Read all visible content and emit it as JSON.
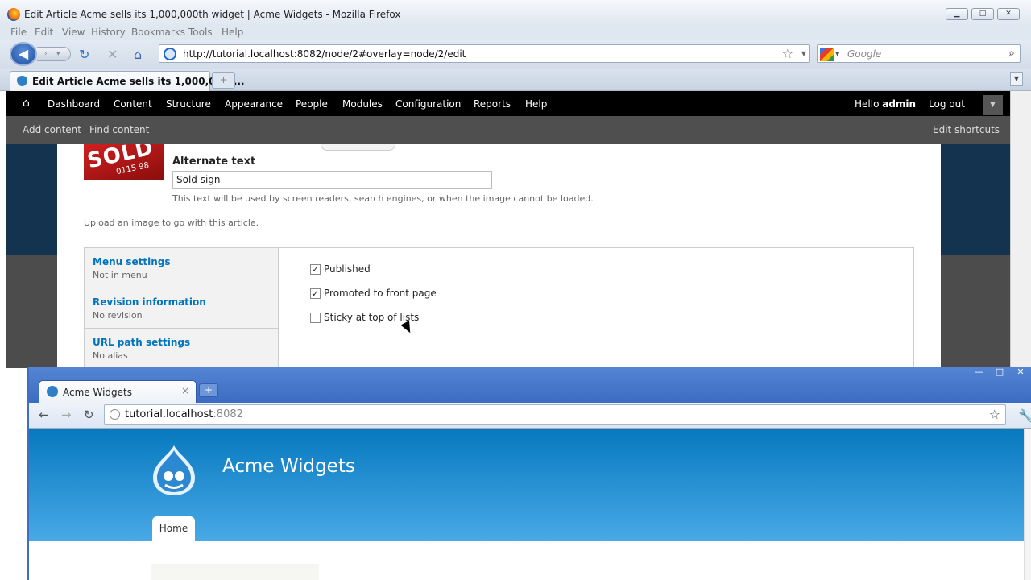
{
  "firefox": {
    "title": "Edit Article Acme sells its 1,000,000th widget | Acme Widgets - Mozilla Firefox",
    "menu": [
      "File",
      "Edit",
      "View",
      "History",
      "Bookmarks",
      "Tools",
      "Help"
    ],
    "url": "http://tutorial.localhost:8082/node/2#overlay=node/2/edit",
    "search_placeholder": "Google",
    "tab_label": "Edit Article Acme sells its 1,000,000t...",
    "new_tab": "+"
  },
  "toolbar": {
    "items": [
      "Dashboard",
      "Content",
      "Structure",
      "Appearance",
      "People",
      "Modules",
      "Configuration",
      "Reports",
      "Help"
    ],
    "hello_prefix": "Hello ",
    "user": "admin",
    "logout": "Log out"
  },
  "shortcuts": {
    "items": [
      "Add content",
      "Find content"
    ],
    "edit": "Edit shortcuts"
  },
  "image_field": {
    "sold_text": "SOLD",
    "sold_phone": "0115 98",
    "alt_label": "Alternate text",
    "alt_value": "Sold sign",
    "alt_desc": "This text will be used by screen readers, search engines, or when the image cannot be loaded.",
    "upload_desc": "Upload an image to go with this article."
  },
  "vertical_tabs": [
    {
      "title": "Menu settings",
      "summary": "Not in menu"
    },
    {
      "title": "Revision information",
      "summary": "No revision"
    },
    {
      "title": "URL path settings",
      "summary": "No alias"
    }
  ],
  "publishing": {
    "options": [
      {
        "label": "Published",
        "checked": true
      },
      {
        "label": "Promoted to front page",
        "checked": true
      },
      {
        "label": "Sticky at top of lists",
        "checked": false
      }
    ]
  },
  "chrome": {
    "tab_label": "Acme Widgets",
    "tab_close": "×",
    "new_tab": "+",
    "url_host": "tutorial.localhost",
    "url_port": ":8082",
    "site_name": "Acme Widgets",
    "home_tab": "Home"
  },
  "colors": {
    "drupal_toolbar": "#000000",
    "shortcut_bar": "#4f4f4f",
    "site_header_top": "#0779bf",
    "link_blue": "#0074bd"
  }
}
